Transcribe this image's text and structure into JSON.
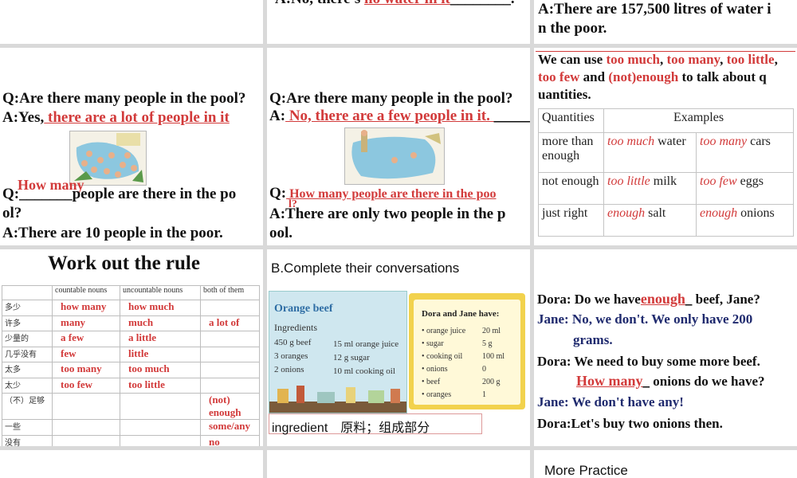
{
  "top": {
    "mid_answer_prefix": "A:No, there's ",
    "mid_answer_fill": "no water in it",
    "mid_answer_suffix": ".",
    "right_line1": "A:There are 157,500 litres of water i",
    "right_line2": "n the poor."
  },
  "slide1": {
    "q": "Q:Are there many people in the pool?",
    "a_prefix": "A:Yes,",
    "a_fill": " there are a lot of people in it",
    "q2_fill": "How many",
    "q2_text": "Q:_______people are there in the po",
    "q2_line2": "ol?",
    "a2": "A:There are 10 people in the poor."
  },
  "slide2": {
    "q": "Q:Are there many people in the pool?",
    "a_prefix": "A:",
    "a_fill": " No, there are a few people in it. ",
    "a_suffix": ".",
    "q2_prefix": "Q:",
    "q2_fill": " How many people are there in the poo",
    "q2_fill2": "l?",
    "a2_line1": "A:There are only two people in the p",
    "a2_line2": "ool."
  },
  "slide3": {
    "intro": [
      {
        "t": "We can use ",
        "red": false
      },
      {
        "t": "too much",
        "red": true
      },
      {
        "t": ", ",
        "red": false
      },
      {
        "t": "too many",
        "red": true
      },
      {
        "t": ", ",
        "red": false
      },
      {
        "t": "too little",
        "red": true
      },
      {
        "t": ",",
        "red": false
      }
    ],
    "intro2": [
      {
        "t": " too few",
        "red": true
      },
      {
        "t": " and ",
        "red": false
      },
      {
        "t": "(not)enough",
        "red": true
      },
      {
        "t": " to talk about q",
        "red": false
      }
    ],
    "intro3": "uantities.",
    "headers": [
      "Quantities",
      "Examples"
    ],
    "rows": [
      {
        "q": "more than enough",
        "e1a": "too much",
        "e1b": " water",
        "e2a": "too many",
        "e2b": " cars"
      },
      {
        "q": "not enough",
        "e1a": "too little",
        "e1b": " milk",
        "e2a": "too few",
        "e2b": " eggs"
      },
      {
        "q": "just right",
        "e1a": "enough",
        "e1b": " salt",
        "e2a": "enough",
        "e2b": " onions"
      }
    ]
  },
  "slide4": {
    "title": "Work out the rule",
    "headers": [
      "",
      "countable nouns",
      "uncountable nouns",
      "both of them"
    ],
    "rows": [
      {
        "label": "多少",
        "c": "how many",
        "u": "how much",
        "b": ""
      },
      {
        "label": "许多",
        "c": "many",
        "u": "much",
        "b": "a lot of"
      },
      {
        "label": "少量的",
        "c": "a few",
        "u": "a little",
        "b": ""
      },
      {
        "label": "几乎没有",
        "c": "few",
        "u": "little",
        "b": ""
      },
      {
        "label": "太多",
        "c": "too many",
        "u": "too much",
        "b": ""
      },
      {
        "label": "太少",
        "c": "too few",
        "u": "too  little",
        "b": ""
      },
      {
        "label": "（不）足够",
        "c": "",
        "u": "",
        "b": "(not) enough"
      },
      {
        "label": "一些",
        "c": "",
        "u": "",
        "b": "some/any"
      },
      {
        "label": "没有",
        "c": "",
        "u": "",
        "b": "no"
      }
    ]
  },
  "slide5": {
    "title": "B.Complete their conversations",
    "recipe_title": "Orange beef",
    "recipe_sub": "Ingredients",
    "recipe_left": [
      "450 g beef",
      "3 oranges",
      "2 onions"
    ],
    "recipe_right": [
      "15 ml orange juice",
      "12 g sugar",
      "10 ml cooking oil"
    ],
    "have_title": "Dora and Jane have:",
    "have_items": [
      {
        "name": "orange juice",
        "qty": "20 ml"
      },
      {
        "name": "sugar",
        "qty": "5 g"
      },
      {
        "name": "cooking oil",
        "qty": "100 ml"
      },
      {
        "name": "onions",
        "qty": "0"
      },
      {
        "name": "beef",
        "qty": "200 g"
      },
      {
        "name": "oranges",
        "qty": "1"
      }
    ],
    "vocab": "ingredient　原料；组成部分"
  },
  "slide6": {
    "l1_prefix": "Dora: Do we have",
    "l1_fill": "enough",
    "l1_suffix": " beef, Jane?",
    "l2": "Jane: No, we don't. We only have 200",
    "l2b": "grams.",
    "l3": "Dora: We need to buy some more beef.",
    "l4_fill": "How many",
    "l4_suffix": " onions do we have?",
    "l5": "Jane: We don't have any!",
    "l6": "Dora:Let's buy two onions then."
  },
  "bottom": {
    "more_practice": "More Practice"
  }
}
